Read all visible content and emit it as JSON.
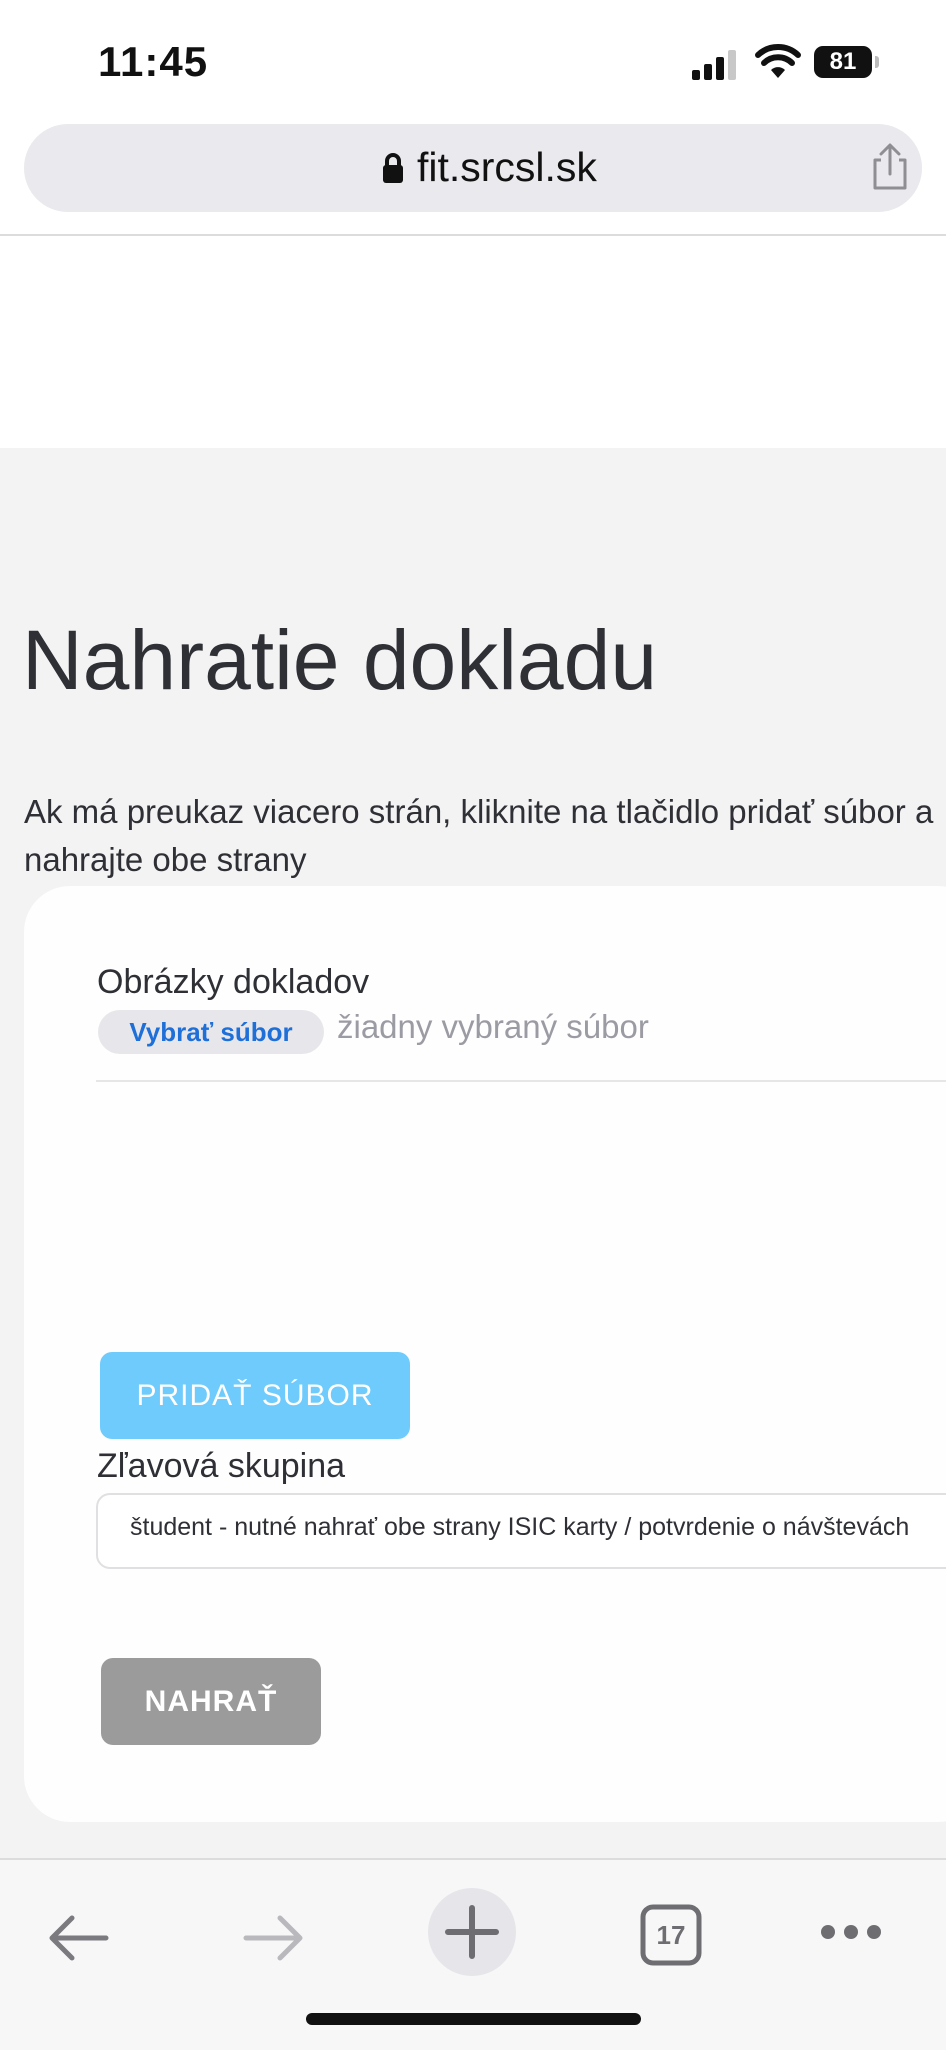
{
  "status": {
    "time": "11:45",
    "battery": "81"
  },
  "browser": {
    "url": "fit.srcsl.sk",
    "tab_count": "17"
  },
  "page": {
    "title": "Nahratie dokladu",
    "description": "Ak má preukaz viacero strán, kliknite na tlačidlo pridať súbor a nahrajte obe strany"
  },
  "form": {
    "images_label": "Obrázky dokladov",
    "choose_file_label": "Vybrať súbor",
    "file_status": "žiadny vybraný súbor",
    "add_file_label": "PRIDAŤ SÚBOR",
    "discount_label": "Zľavová skupina",
    "discount_value": "študent - nutné nahrať obe strany ISIC karty / potvrdenie o návštevách",
    "upload_label": "NAHRAŤ"
  },
  "colors": {
    "add_button": "#6ecbfc",
    "upload_button": "#9b9b9b",
    "link_blue": "#1f6fd8",
    "page_background": "#f3f3f4"
  },
  "icons": [
    "signal-icon",
    "wifi-icon",
    "battery-icon",
    "lock-icon",
    "share-icon",
    "back-arrow-icon",
    "forward-arrow-icon",
    "new-tab-icon",
    "tabs-icon",
    "more-icon"
  ]
}
